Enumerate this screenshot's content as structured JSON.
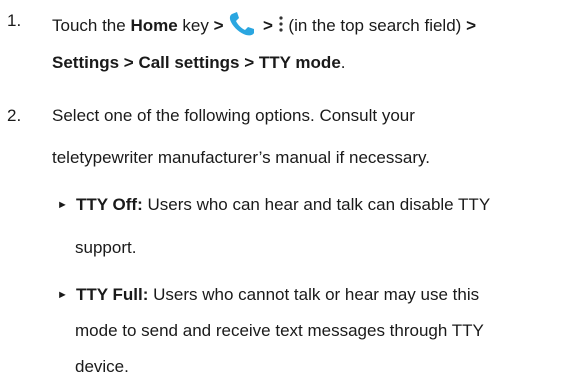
{
  "steps": [
    {
      "number": "1.",
      "line1": {
        "t1": "Touch the ",
        "home_key": "Home",
        "t2": " key ",
        "sep1": ">",
        "sep2": ">",
        "t3": " (in the top search field) ",
        "sep3": ">"
      },
      "line2": {
        "settings": "Settings",
        "sep4": " > ",
        "call_settings": "Call settings",
        "sep5": " > ",
        "tty_mode": "TTY mode",
        "period": "."
      },
      "icons": {
        "phone": "phone-icon",
        "more": "more-vert-icon"
      }
    },
    {
      "number": "2.",
      "line1": "Select one of the following options. Consult your",
      "line2": "teletypewriter manufacturer’s manual if necessary."
    }
  ],
  "options": [
    {
      "bullet": "►",
      "label": "TTY Off:",
      "text1": " Users who can hear and talk can disable TTY",
      "text2": "support."
    },
    {
      "bullet": "►",
      "label": "TTY Full:",
      "text1": " Users who cannot talk or hear may use this",
      "text2": "mode to send and receive text messages through TTY",
      "text3": "device."
    }
  ],
  "colors": {
    "phone_icon": "#2aa6e0",
    "text": "#1a1a1a"
  }
}
